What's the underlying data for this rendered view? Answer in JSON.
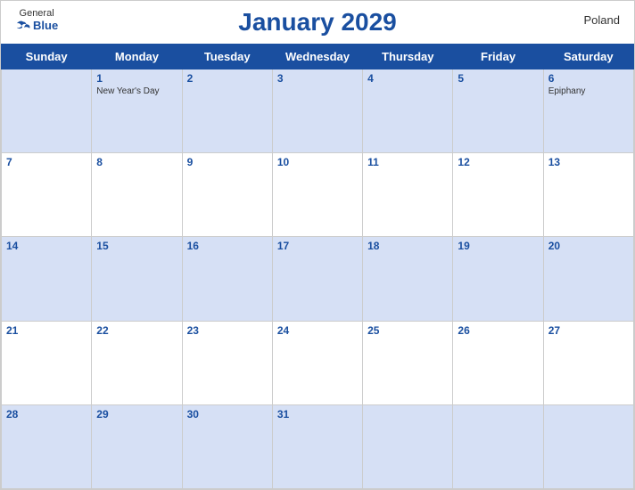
{
  "header": {
    "title": "January 2029",
    "country": "Poland",
    "logo": {
      "general": "General",
      "blue": "Blue"
    }
  },
  "days_of_week": [
    "Sunday",
    "Monday",
    "Tuesday",
    "Wednesday",
    "Thursday",
    "Friday",
    "Saturday"
  ],
  "weeks": [
    [
      {
        "day": "",
        "holiday": ""
      },
      {
        "day": "1",
        "holiday": "New Year's Day"
      },
      {
        "day": "2",
        "holiday": ""
      },
      {
        "day": "3",
        "holiday": ""
      },
      {
        "day": "4",
        "holiday": ""
      },
      {
        "day": "5",
        "holiday": ""
      },
      {
        "day": "6",
        "holiday": "Epiphany"
      }
    ],
    [
      {
        "day": "7",
        "holiday": ""
      },
      {
        "day": "8",
        "holiday": ""
      },
      {
        "day": "9",
        "holiday": ""
      },
      {
        "day": "10",
        "holiday": ""
      },
      {
        "day": "11",
        "holiday": ""
      },
      {
        "day": "12",
        "holiday": ""
      },
      {
        "day": "13",
        "holiday": ""
      }
    ],
    [
      {
        "day": "14",
        "holiday": ""
      },
      {
        "day": "15",
        "holiday": ""
      },
      {
        "day": "16",
        "holiday": ""
      },
      {
        "day": "17",
        "holiday": ""
      },
      {
        "day": "18",
        "holiday": ""
      },
      {
        "day": "19",
        "holiday": ""
      },
      {
        "day": "20",
        "holiday": ""
      }
    ],
    [
      {
        "day": "21",
        "holiday": ""
      },
      {
        "day": "22",
        "holiday": ""
      },
      {
        "day": "23",
        "holiday": ""
      },
      {
        "day": "24",
        "holiday": ""
      },
      {
        "day": "25",
        "holiday": ""
      },
      {
        "day": "26",
        "holiday": ""
      },
      {
        "day": "27",
        "holiday": ""
      }
    ],
    [
      {
        "day": "28",
        "holiday": ""
      },
      {
        "day": "29",
        "holiday": ""
      },
      {
        "day": "30",
        "holiday": ""
      },
      {
        "day": "31",
        "holiday": ""
      },
      {
        "day": "",
        "holiday": ""
      },
      {
        "day": "",
        "holiday": ""
      },
      {
        "day": "",
        "holiday": ""
      }
    ]
  ],
  "colors": {
    "header_bg": "#1a4fa0",
    "shaded_row": "#d6e0f5",
    "title_color": "#1a4fa0"
  }
}
